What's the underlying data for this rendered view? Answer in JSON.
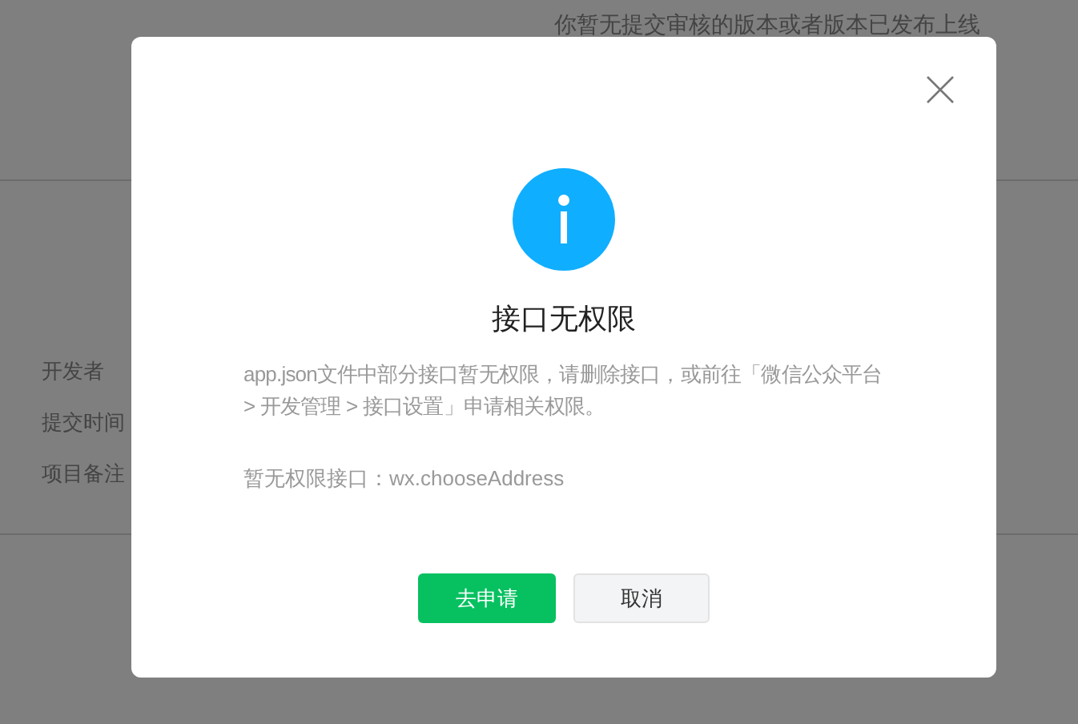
{
  "background": {
    "notice": "你暂无提交审核的版本或者版本已发布上线",
    "fields": [
      {
        "label": "开发者"
      },
      {
        "label": "提交时间"
      },
      {
        "label": "项目备注"
      }
    ]
  },
  "dialog": {
    "title": "接口无权限",
    "message": "app.json文件中部分接口暂无权限，请删除接口，或前往「微信公众平台 > 开发管理 > 接口设置」申请相关权限。",
    "detail": "暂无权限接口：wx.chooseAddress",
    "buttons": [
      {
        "label": "去申请",
        "kind": "primary"
      },
      {
        "label": "取消",
        "kind": "default"
      }
    ]
  }
}
